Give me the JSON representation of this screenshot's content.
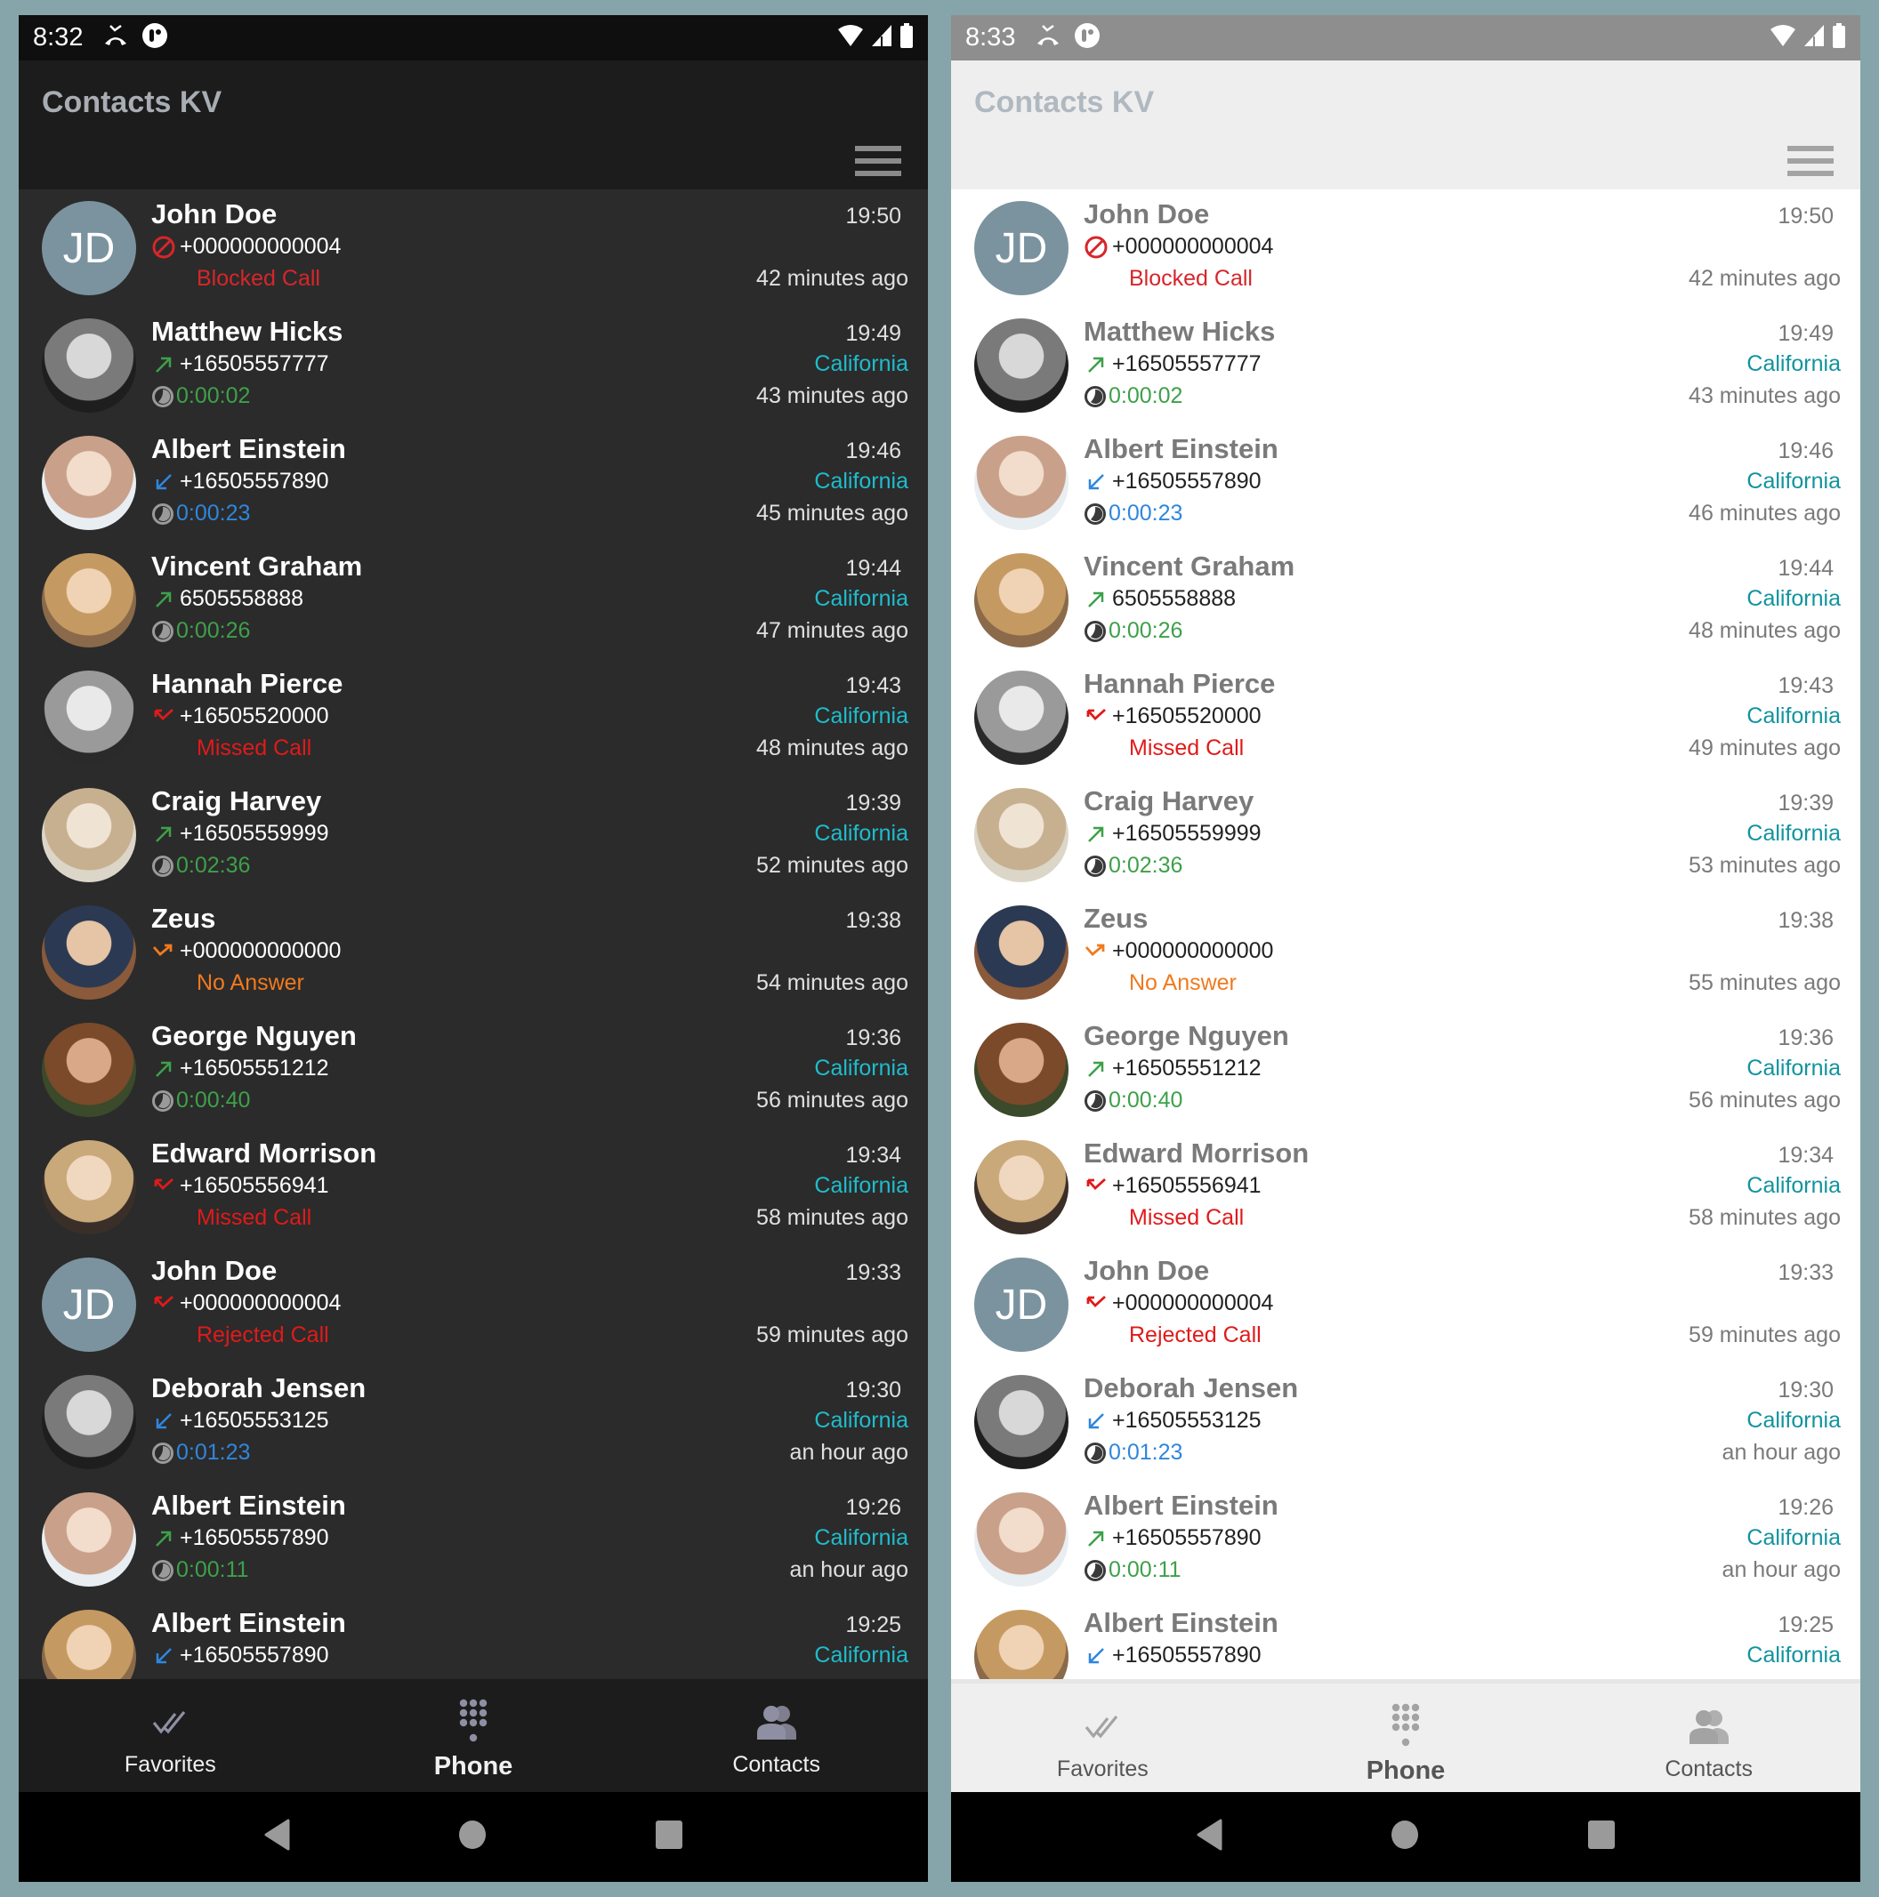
{
  "colors": {
    "backdrop": "#86a5ab",
    "blocked": "#d6262a",
    "missed": "#e01a1a",
    "rejected": "#e01a1a",
    "no_answer": "#f07a1e",
    "outgoing": "#3ea04a",
    "incoming": "#2f86dd",
    "region_dark": "#1fbccc",
    "region_light": "#12939e",
    "avatar_initials_bg": "#7b939f"
  },
  "panels": [
    {
      "theme": "dark",
      "statusbar": {
        "time": "8:32"
      },
      "app_title": "Contacts KV",
      "calls": [
        {
          "name": "John Doe",
          "initials": "JD",
          "type": "blocked",
          "number": "+000000000004",
          "status": "Blocked Call",
          "time": "19:50",
          "region": "",
          "ago": "42 minutes ago"
        },
        {
          "name": "Matthew Hicks",
          "type": "outgoing",
          "number": "+16505557777",
          "duration": "0:00:02",
          "time": "19:49",
          "region": "California",
          "ago": "43 minutes ago"
        },
        {
          "name": "Albert Einstein",
          "type": "incoming",
          "number": "+16505557890",
          "duration": "0:00:23",
          "time": "19:46",
          "region": "California",
          "ago": "45 minutes ago"
        },
        {
          "name": "Vincent Graham",
          "type": "outgoing",
          "number": "6505558888",
          "duration": "0:00:26",
          "time": "19:44",
          "region": "California",
          "ago": "47 minutes ago"
        },
        {
          "name": "Hannah Pierce",
          "type": "missed",
          "number": "+16505520000",
          "status": "Missed Call",
          "time": "19:43",
          "region": "California",
          "ago": "48 minutes ago"
        },
        {
          "name": "Craig Harvey",
          "type": "outgoing",
          "number": "+16505559999",
          "duration": "0:02:36",
          "time": "19:39",
          "region": "California",
          "ago": "52 minutes ago"
        },
        {
          "name": "Zeus",
          "type": "no_answer",
          "number": "+000000000000",
          "status": "No Answer",
          "time": "19:38",
          "region": "",
          "ago": "54 minutes ago"
        },
        {
          "name": "George Nguyen",
          "type": "outgoing",
          "number": "+16505551212",
          "duration": "0:00:40",
          "time": "19:36",
          "region": "California",
          "ago": "56 minutes ago"
        },
        {
          "name": "Edward Morrison",
          "type": "missed",
          "number": "+16505556941",
          "status": "Missed Call",
          "time": "19:34",
          "region": "California",
          "ago": "58 minutes ago"
        },
        {
          "name": "John Doe",
          "initials": "JD",
          "type": "rejected",
          "number": "+000000000004",
          "status": "Rejected Call",
          "time": "19:33",
          "region": "",
          "ago": "59 minutes ago"
        },
        {
          "name": "Deborah Jensen",
          "type": "incoming",
          "number": "+16505553125",
          "duration": "0:01:23",
          "time": "19:30",
          "region": "California",
          "ago": "an hour ago"
        },
        {
          "name": "Albert Einstein",
          "type": "outgoing",
          "number": "+16505557890",
          "duration": "0:00:11",
          "time": "19:26",
          "region": "California",
          "ago": "an hour ago"
        },
        {
          "name": "Albert Einstein",
          "type": "incoming",
          "number": "+16505557890",
          "duration": "",
          "time": "19:25",
          "region": "California",
          "ago": ""
        }
      ],
      "nav": [
        {
          "label": "Favorites",
          "icon": "double-check-icon",
          "active": false
        },
        {
          "label": "Phone",
          "icon": "dialpad-icon",
          "active": true
        },
        {
          "label": "Contacts",
          "icon": "people-icon",
          "active": false
        }
      ]
    },
    {
      "theme": "light",
      "statusbar": {
        "time": "8:33"
      },
      "app_title": "Contacts KV",
      "calls": [
        {
          "name": "John Doe",
          "initials": "JD",
          "type": "blocked",
          "number": "+000000000004",
          "status": "Blocked Call",
          "time": "19:50",
          "region": "",
          "ago": "42 minutes ago"
        },
        {
          "name": "Matthew Hicks",
          "type": "outgoing",
          "number": "+16505557777",
          "duration": "0:00:02",
          "time": "19:49",
          "region": "California",
          "ago": "43 minutes ago"
        },
        {
          "name": "Albert Einstein",
          "type": "incoming",
          "number": "+16505557890",
          "duration": "0:00:23",
          "time": "19:46",
          "region": "California",
          "ago": "46 minutes ago"
        },
        {
          "name": "Vincent Graham",
          "type": "outgoing",
          "number": "6505558888",
          "duration": "0:00:26",
          "time": "19:44",
          "region": "California",
          "ago": "48 minutes ago"
        },
        {
          "name": "Hannah Pierce",
          "type": "missed",
          "number": "+16505520000",
          "status": "Missed Call",
          "time": "19:43",
          "region": "California",
          "ago": "49 minutes ago"
        },
        {
          "name": "Craig Harvey",
          "type": "outgoing",
          "number": "+16505559999",
          "duration": "0:02:36",
          "time": "19:39",
          "region": "California",
          "ago": "53 minutes ago"
        },
        {
          "name": "Zeus",
          "type": "no_answer",
          "number": "+000000000000",
          "status": "No Answer",
          "time": "19:38",
          "region": "",
          "ago": "55 minutes ago"
        },
        {
          "name": "George Nguyen",
          "type": "outgoing",
          "number": "+16505551212",
          "duration": "0:00:40",
          "time": "19:36",
          "region": "California",
          "ago": "56 minutes ago"
        },
        {
          "name": "Edward Morrison",
          "type": "missed",
          "number": "+16505556941",
          "status": "Missed Call",
          "time": "19:34",
          "region": "California",
          "ago": "58 minutes ago"
        },
        {
          "name": "John Doe",
          "initials": "JD",
          "type": "rejected",
          "number": "+000000000004",
          "status": "Rejected Call",
          "time": "19:33",
          "region": "",
          "ago": "59 minutes ago"
        },
        {
          "name": "Deborah Jensen",
          "type": "incoming",
          "number": "+16505553125",
          "duration": "0:01:23",
          "time": "19:30",
          "region": "California",
          "ago": "an hour ago"
        },
        {
          "name": "Albert Einstein",
          "type": "outgoing",
          "number": "+16505557890",
          "duration": "0:00:11",
          "time": "19:26",
          "region": "California",
          "ago": "an hour ago"
        },
        {
          "name": "Albert Einstein",
          "type": "incoming",
          "number": "+16505557890",
          "duration": "",
          "time": "19:25",
          "region": "California",
          "ago": ""
        }
      ],
      "nav": [
        {
          "label": "Favorites",
          "icon": "double-check-icon",
          "active": false
        },
        {
          "label": "Phone",
          "icon": "dialpad-icon",
          "active": true
        },
        {
          "label": "Contacts",
          "icon": "people-icon",
          "active": false
        }
      ]
    }
  ]
}
